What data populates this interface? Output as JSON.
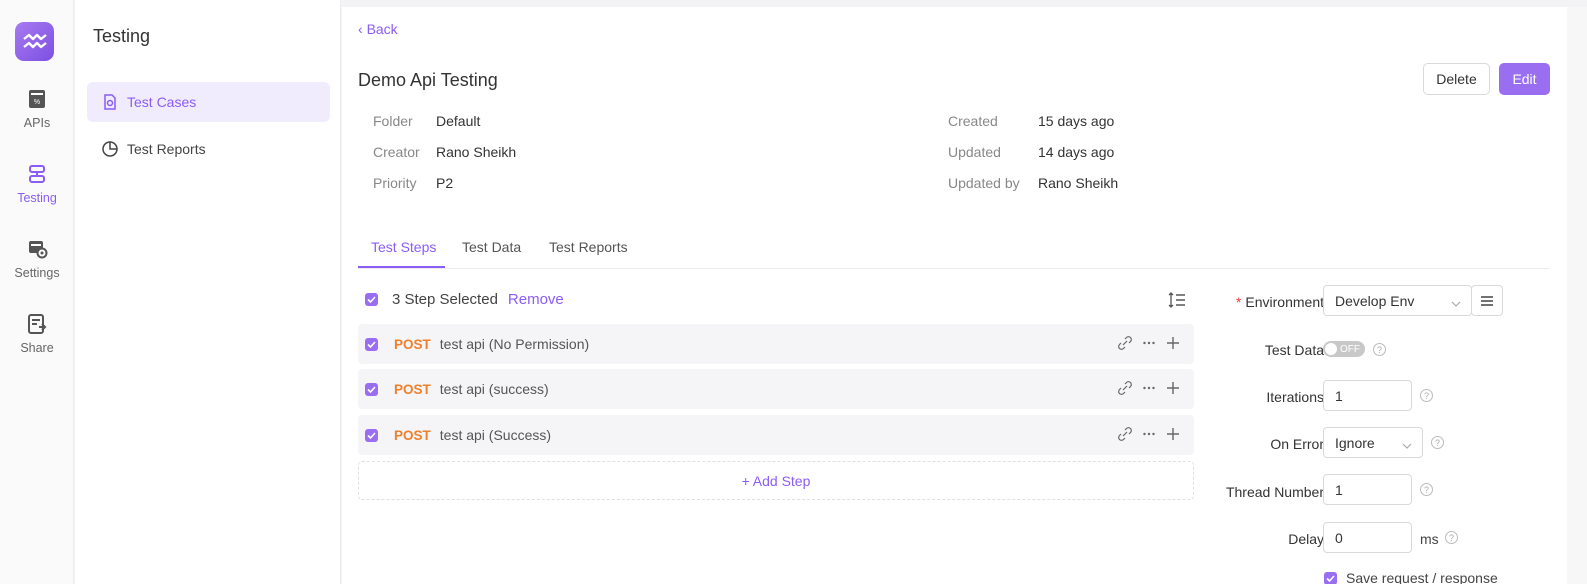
{
  "rail": {
    "items": [
      {
        "label": "APIs",
        "icon": "api-doc-icon"
      },
      {
        "label": "Testing",
        "icon": "testing-icon",
        "active": true
      },
      {
        "label": "Settings",
        "icon": "settings-icon"
      },
      {
        "label": "Share",
        "icon": "share-icon"
      }
    ]
  },
  "subnav": {
    "title": "Testing",
    "items": [
      {
        "label": "Test Cases",
        "icon": "test-case-icon",
        "active": true
      },
      {
        "label": "Test Reports",
        "icon": "pie-chart-icon"
      }
    ]
  },
  "header": {
    "back_label": "Back",
    "title": "Demo Api Testing",
    "delete_label": "Delete",
    "edit_label": "Edit"
  },
  "meta": {
    "folder_label": "Folder",
    "folder": "Default",
    "creator_label": "Creator",
    "creator": "Rano Sheikh",
    "priority_label": "Priority",
    "priority": "P2",
    "created_label": "Created",
    "created": "15 days ago",
    "updated_label": "Updated",
    "updated": "14 days ago",
    "updated_by_label": "Updated by",
    "updated_by": "Rano Sheikh"
  },
  "tabs": [
    "Test Steps",
    "Test Data",
    "Test Reports"
  ],
  "selection": {
    "text": "3 Step Selected",
    "remove_label": "Remove"
  },
  "steps": [
    {
      "method": "POST",
      "name": "test api (No Permission)"
    },
    {
      "method": "POST",
      "name": "test api (success)"
    },
    {
      "method": "POST",
      "name": "test api (Success)"
    }
  ],
  "add_step_label": "Add Step",
  "settings": {
    "environment_label": "Environment",
    "environment_value": "Develop Env",
    "test_data_label": "Test Data",
    "test_data_switch": "OFF",
    "iterations_label": "Iterations",
    "iterations_value": "1",
    "on_error_label": "On Error",
    "on_error_value": "Ignore",
    "thread_label": "Thread Number",
    "thread_value": "1",
    "delay_label": "Delay",
    "delay_value": "0",
    "delay_unit": "ms",
    "save_req_label": "Save request / response"
  },
  "colors": {
    "accent": "#8b5cf6",
    "method_post": "#f07f2a"
  }
}
